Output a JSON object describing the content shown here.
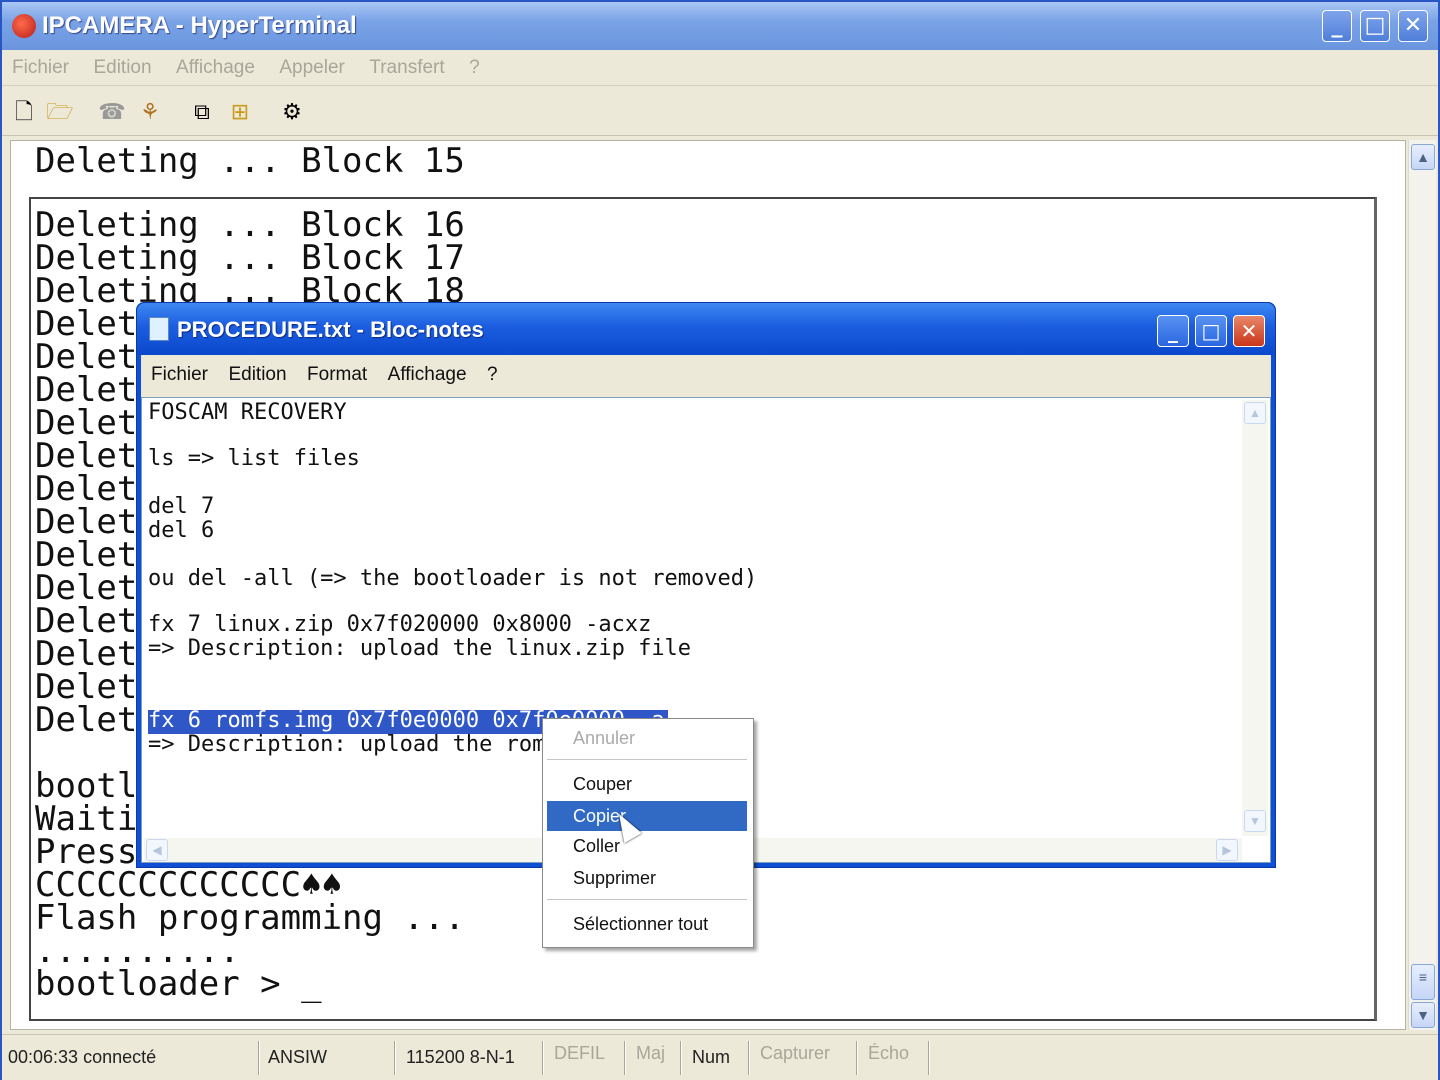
{
  "window": {
    "title": "IPCAMERA - HyperTerminal",
    "controls": {
      "minimize": "_",
      "maximize": "□",
      "close": "✕"
    }
  },
  "menu": [
    "Fichier",
    "Edition",
    "Affichage",
    "Appeler",
    "Transfert",
    "?"
  ],
  "toolbar": {
    "icons": [
      "new-icon",
      "open-icon",
      "disconnect-icon",
      "call-icon",
      "send-icon",
      "receive-icon",
      "properties-icon"
    ]
  },
  "terminal": {
    "top_line": "Deleting ... Block 15",
    "lines": [
      "Deleting ... Block 16",
      "Deleting ... Block 17",
      "Deleting ... Block 18",
      "Deleti",
      "Deleti",
      "Deleti",
      "Deleti",
      "Deleti",
      "Deleti",
      "Deleti",
      "Deleti",
      "Deleti",
      "Deleti",
      "Deleti",
      "Deleti",
      "Deleti",
      "",
      "bootlo",
      "Waitin",
      "Press",
      "CCCCCCCCCCCCC♠♠",
      "Flash programming ...",
      "..........",
      "bootloader > _"
    ]
  },
  "notepad": {
    "title": "PROCEDURE.txt - Bloc-notes",
    "menu": [
      "Fichier",
      "Edition",
      "Format",
      "Affichage",
      "?"
    ],
    "lines": [
      "FOSCAM RECOVERY",
      "",
      "ls => list files",
      "",
      "del 7",
      "del 6",
      "",
      "ou del -all (=> the bootloader is not removed)",
      "",
      "fx 7 linux.zip 0x7f020000 0x8000 -acxz",
      "=> Description: upload the linux.zip file",
      "",
      "",
      "fx 6 romfs.img 0x7f0e0000 0x7f0e0000 -a",
      "=> Description: upload the rom"
    ]
  },
  "context_menu": {
    "items": [
      {
        "label": "Annuler",
        "enabled": false
      },
      {
        "label": "Couper",
        "enabled": true
      },
      {
        "label": "Copier",
        "enabled": true,
        "selected": true
      },
      {
        "label": "Coller",
        "enabled": true
      },
      {
        "label": "Supprimer",
        "enabled": true
      },
      {
        "label": "Sélectionner tout",
        "enabled": true
      }
    ]
  },
  "status": {
    "connected": "00:06:33 connecté",
    "emulation": "ANSIW",
    "settings": "115200 8-N-1",
    "defil": "DEFIL",
    "maj": "Maj",
    "num": "Num",
    "capture": "Capturer",
    "echo": "Écho"
  }
}
